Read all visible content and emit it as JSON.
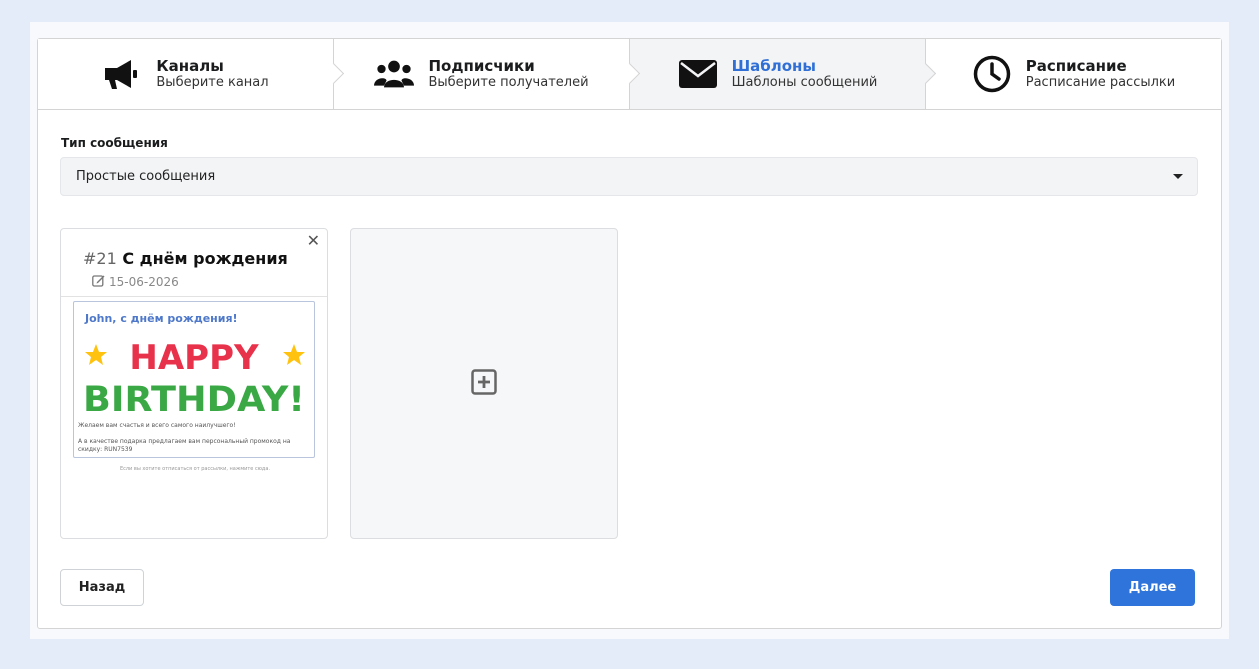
{
  "steps": [
    {
      "title": "Каналы",
      "desc": "Выберите канал",
      "icon": "megaphone-icon",
      "active": false
    },
    {
      "title": "Подписчики",
      "desc": "Выберите получателей",
      "icon": "users-icon",
      "active": false
    },
    {
      "title": "Шаблоны",
      "desc": "Шаблоны сообщений",
      "icon": "envelope-icon",
      "active": true
    },
    {
      "title": "Расписание",
      "desc": "Расписание рассылки",
      "icon": "clock-icon",
      "active": false
    }
  ],
  "message_type": {
    "label": "Тип сообщения",
    "value": "Простые сообщения"
  },
  "templates": [
    {
      "number": "#21",
      "name": "С днём рождения",
      "date": "15-06-2026",
      "preview": {
        "greeting": "John, с днём рождения!",
        "banner_line1": "HAPPY",
        "banner_line2": "BIRTHDAY!",
        "text1": "Желаем вам счастья и всего самого наилучшего!",
        "text2": "А в качестве подарка предлагаем вам персональный промокод на скидку: RUN7539",
        "unsubscribe": "Если вы хотите отписаться от рассылки, нажмите сюда."
      }
    }
  ],
  "buttons": {
    "back": "Назад",
    "next": "Далее"
  },
  "colors": {
    "accent": "#2f74db",
    "active_step_text": "#2f6fd6"
  }
}
